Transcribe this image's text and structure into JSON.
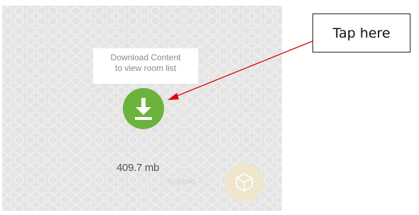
{
  "download": {
    "tooltip_line1": "Download Content",
    "tooltip_line2": "to view room list",
    "button_icon": "download-icon",
    "size_text": "409.7 mb"
  },
  "explore": {
    "label": "Explore",
    "icon": "cube-icon"
  },
  "annotation": {
    "callout_text": "Tap here",
    "arrow_color": "#e00000"
  },
  "colors": {
    "download_button": "#6cb33e",
    "panel_background": "#e4e4e4"
  }
}
